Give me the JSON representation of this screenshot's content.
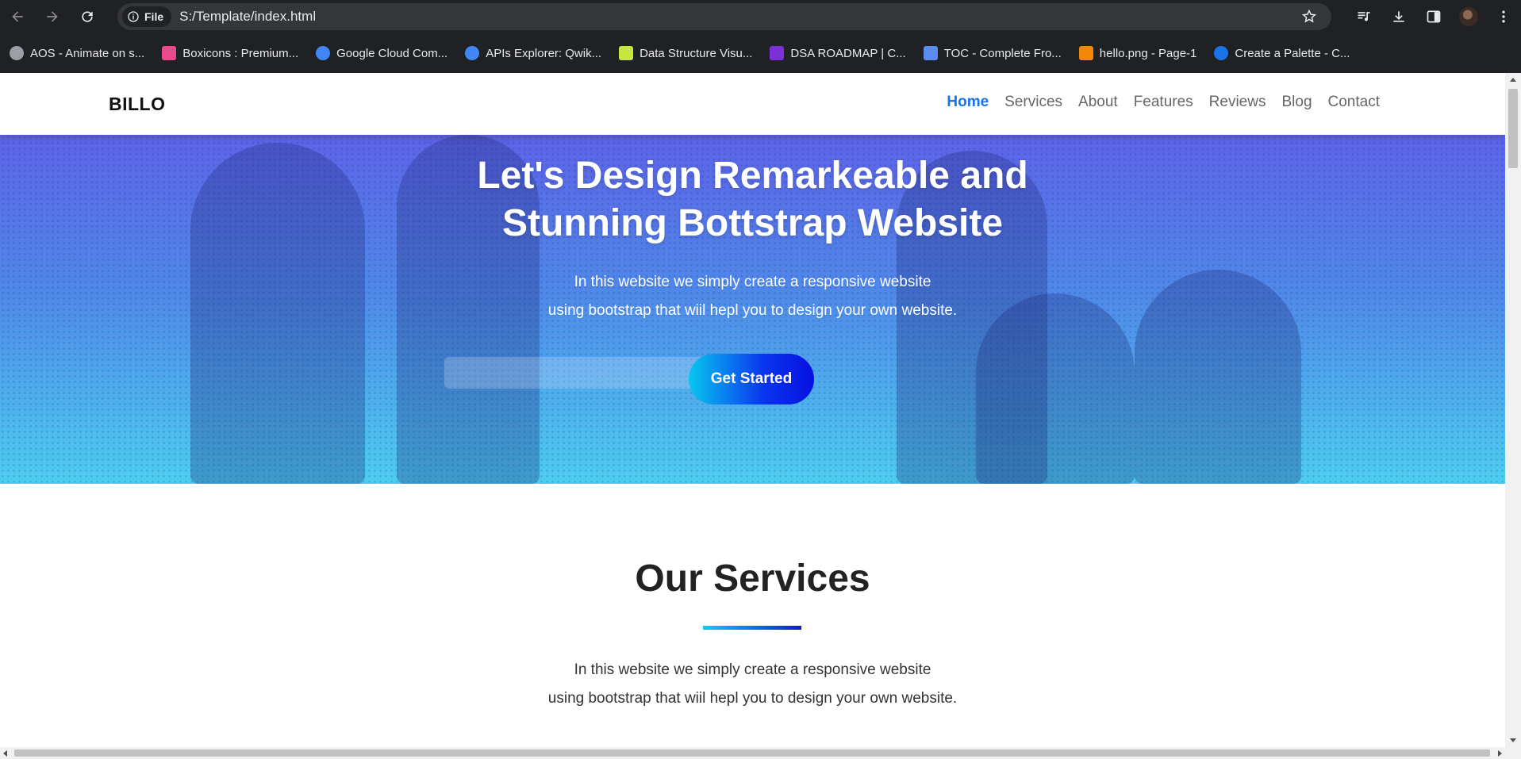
{
  "browser": {
    "chip_label": "File",
    "url": "S:/Template/index.html",
    "bookmarks": [
      {
        "label": "AOS - Animate on s...",
        "icon": "globe-icon",
        "color": "#9aa0a6"
      },
      {
        "label": "Boxicons : Premium...",
        "icon": "boxicons-icon",
        "color": "#e84a8b"
      },
      {
        "label": "Google Cloud Com...",
        "icon": "google-cloud-icon",
        "color": "#4285f4"
      },
      {
        "label": "APIs Explorer: Qwik...",
        "icon": "google-cloud-icon",
        "color": "#4285f4"
      },
      {
        "label": "Data Structure Visu...",
        "icon": "usf-icon",
        "color": "#c9e63c"
      },
      {
        "label": "DSA ROADMAP | C...",
        "icon": "roadmap-icon",
        "color": "#7b2fd6"
      },
      {
        "label": "TOC - Complete Fro...",
        "icon": "toc-icon",
        "color": "#5b8def"
      },
      {
        "label": "hello.png - Page-1",
        "icon": "drawio-icon",
        "color": "#f08705"
      },
      {
        "label": "Create a Palette - C...",
        "icon": "coolors-icon",
        "color": "#1a73e8"
      }
    ]
  },
  "site": {
    "brand": "BILLO",
    "nav": [
      {
        "label": "Home",
        "active": true
      },
      {
        "label": "Services",
        "active": false
      },
      {
        "label": "About",
        "active": false
      },
      {
        "label": "Features",
        "active": false
      },
      {
        "label": "Reviews",
        "active": false
      },
      {
        "label": "Blog",
        "active": false
      },
      {
        "label": "Contact",
        "active": false
      }
    ],
    "hero": {
      "title_line1": "Let's Design Remarkeable and",
      "title_line2": "Stunning Bottstrap Website",
      "subtitle_line1": "In this website we simply create a responsive website",
      "subtitle_line2": "using bootstrap that wiil hepl you to design your own website.",
      "cta_label": "Get Started"
    },
    "services": {
      "title": "Our Services",
      "subtitle_line1": "In this website we simply create a responsive website",
      "subtitle_line2": "using bootstrap that wiil hepl you to design your own website."
    }
  },
  "colors": {
    "accent": "#1a73e8",
    "hero_top": "#5d63e8",
    "hero_bottom": "#4ccdf0",
    "cta_start": "#08c6f0",
    "cta_end": "#0810e0"
  }
}
